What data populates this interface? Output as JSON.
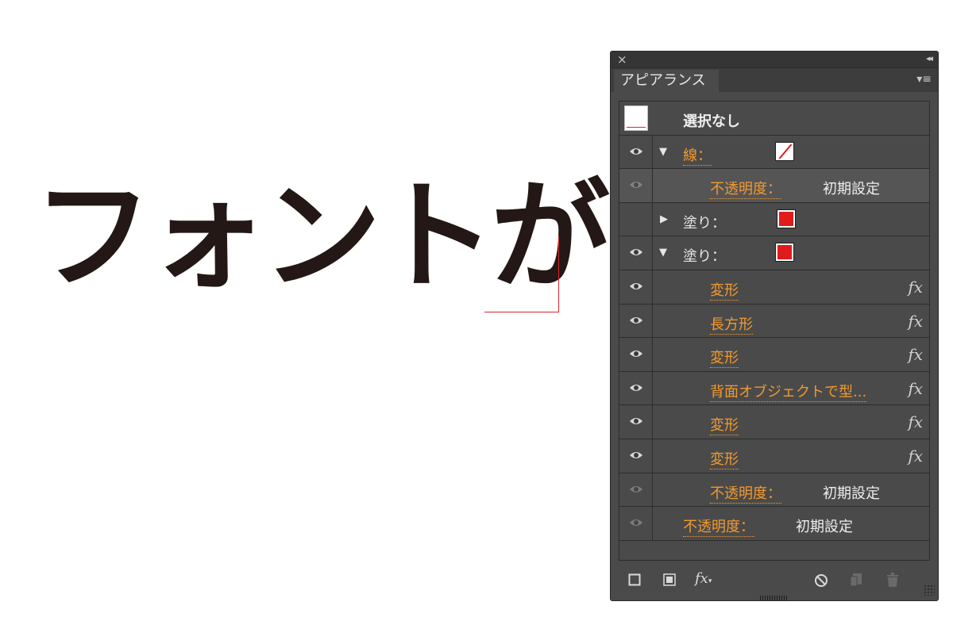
{
  "canvas": {
    "text": "フォントが"
  },
  "panel": {
    "tab_label": "アピアランス",
    "selection_label": "選択なし",
    "rows": [
      {
        "label": "線：",
        "value": ""
      },
      {
        "label": "不透明度：",
        "value": "初期設定"
      },
      {
        "label": "塗り：",
        "value": ""
      },
      {
        "label": "塗り：",
        "value": ""
      },
      {
        "label": "変形",
        "value": ""
      },
      {
        "label": "長方形",
        "value": ""
      },
      {
        "label": "変形",
        "value": ""
      },
      {
        "label": "背面オブジェクトで型...",
        "value": ""
      },
      {
        "label": "変形",
        "value": ""
      },
      {
        "label": "変形",
        "value": ""
      },
      {
        "label": "不透明度：",
        "value": "初期設定"
      },
      {
        "label": "不透明度：",
        "value": "初期設定"
      }
    ],
    "fx_glyph": "fx",
    "icons": {
      "close": "×",
      "collapse": "◂◂",
      "menu": "▾≡",
      "expanded": "▼",
      "collapsed": "▶"
    },
    "colors": {
      "fill_swatch": "#e01b1b",
      "link": "#f29a2e",
      "panel_bg": "#4a4a4a"
    }
  }
}
